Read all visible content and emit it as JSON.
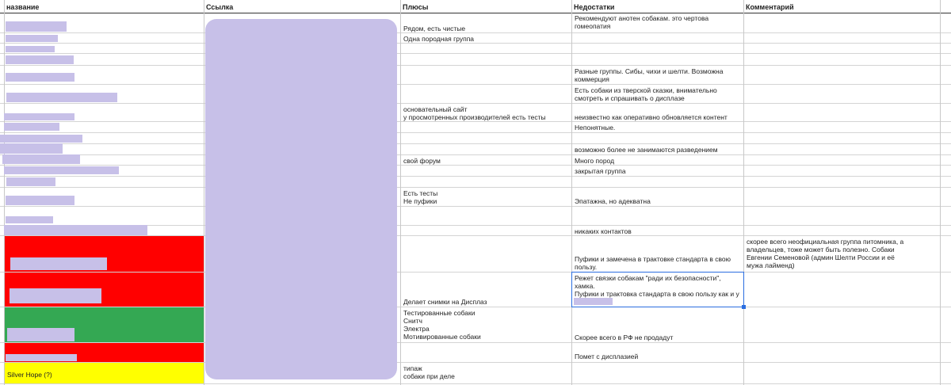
{
  "headers": {
    "name": "название",
    "link": "Ссылка",
    "pros": "Плюсы",
    "cons": "Недостатки",
    "comment": "Комментарий"
  },
  "colors": {
    "red": "#ff0000",
    "green": "#34a853",
    "yellow": "#ffff00",
    "redacted": "#c7c0e8",
    "selection": "#2b6ee0"
  },
  "rows": {
    "r1": {
      "cons": "Рекомендуют анотен собакам. это чертова\nгомеопатия"
    },
    "r2": {
      "pros": "Рядом, есть чистые"
    },
    "r3": {
      "pros": "Одна породная группа"
    },
    "r7": {
      "cons": "Разные группы. Сибы, чихи и шелти. Возможна\nкоммерция"
    },
    "r8": {
      "cons": "Есть собаки из тверской сказки, внимательно\nсмотреть и спрашивать о дисплазе"
    },
    "r9": {
      "pros": "основательный сайт\nу просмотренных производителей есть тесты",
      "cons": "неизвестно как оперативно обновляется контент"
    },
    "r10": {
      "cons": "Непонятные."
    },
    "r13": {
      "cons": "возможно более не занимаются разведением"
    },
    "r14": {
      "pros": "свой форум",
      "cons": "Много пород"
    },
    "r15": {
      "cons": "закрытая группа"
    },
    "r17": {
      "pros": "Есть тесты\nНе пуфики",
      "cons": "Эпатажна, но адекватна"
    },
    "r20": {
      "cons": "никаких контактов"
    },
    "r21": {
      "cons": "Пуфики и замечена в  трактовке стандарта в свою\nпользу.",
      "comment": "скорее всего неофициальная группа питомника, а\nвладельцев, тоже может быть полезно. Собаки\nЕвгении Семеновой (админ Шелти России и её\nмужа лайменд)"
    },
    "r22": {
      "pros": "Делает снимки на Дисплаз",
      "cons": "Режет связки собакам \"ради их безопасности\",\nхамка.\nПуфики и трактовка стандарта в свою пользу как и у"
    },
    "r23": {
      "pros": "Тестированные собаки\nСнитч\nЭлектра\nМотивированные собаки",
      "cons": "Скорее всего в РФ не продадут"
    },
    "r24": {
      "cons": "Помет с дисплазией"
    },
    "r25": {
      "name": "Silver Hope (?)",
      "pros": "типаж\nсобаки при деле"
    }
  }
}
